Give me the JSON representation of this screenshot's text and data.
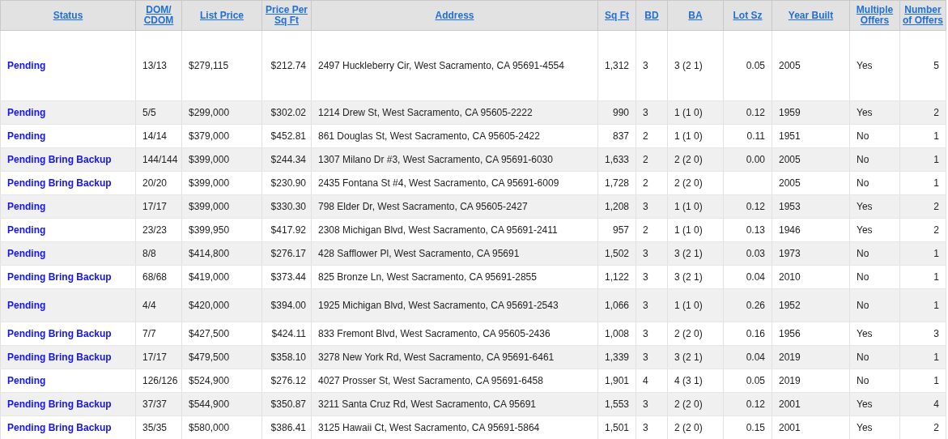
{
  "table": {
    "columns": [
      "Status",
      "DOM/ CDOM",
      "List Price",
      "Price Per Sq Ft",
      "Address",
      "Sq Ft",
      "BD",
      "BA",
      "Lot Sz",
      "Year Built",
      "Multiple Offers",
      "Number of Offers"
    ],
    "rows": [
      {
        "status": "Pending",
        "dom": "13/13",
        "list_price": "$279,115",
        "price_per_sqft": "$212.74",
        "address": "2497 Huckleberry Cir, West Sacramento, CA 95691-4554",
        "sqft": "1,312",
        "bd": "3",
        "ba": "3 (2 1)",
        "lot_sz": "0.05",
        "year_built": "2005",
        "multiple_offers": "Yes",
        "number_of_offers": "5"
      },
      {
        "status": "Pending",
        "dom": "5/5",
        "list_price": "$299,000",
        "price_per_sqft": "$302.02",
        "address": "1214 Drew St, West Sacramento, CA 95605-2222",
        "sqft": "990",
        "bd": "3",
        "ba": "1 (1 0)",
        "lot_sz": "0.12",
        "year_built": "1959",
        "multiple_offers": "Yes",
        "number_of_offers": "2"
      },
      {
        "status": "Pending",
        "dom": "14/14",
        "list_price": "$379,000",
        "price_per_sqft": "$452.81",
        "address": "861 Douglas St, West Sacramento, CA 95605-2422",
        "sqft": "837",
        "bd": "2",
        "ba": "1 (1 0)",
        "lot_sz": "0.11",
        "year_built": "1951",
        "multiple_offers": "No",
        "number_of_offers": "1"
      },
      {
        "status": "Pending Bring Backup",
        "dom": "144/144",
        "list_price": "$399,000",
        "price_per_sqft": "$244.34",
        "address": "1307 Milano Dr #3, West Sacramento, CA 95691-6030",
        "sqft": "1,633",
        "bd": "2",
        "ba": "2 (2 0)",
        "lot_sz": "0.00",
        "year_built": "2005",
        "multiple_offers": "No",
        "number_of_offers": "1"
      },
      {
        "status": "Pending Bring Backup",
        "dom": "20/20",
        "list_price": "$399,000",
        "price_per_sqft": "$230.90",
        "address": "2435 Fontana St #4, West Sacramento, CA 95691-6009",
        "sqft": "1,728",
        "bd": "2",
        "ba": "2 (2 0)",
        "year_built": "2005",
        "multiple_offers": "No",
        "number_of_offers": "1"
      },
      {
        "status": "Pending",
        "dom": "17/17",
        "list_price": "$399,000",
        "price_per_sqft": "$330.30",
        "address": "798 Elder Dr, West Sacramento, CA 95605-2427",
        "sqft": "1,208",
        "bd": "3",
        "ba": "1 (1 0)",
        "lot_sz": "0.12",
        "year_built": "1953",
        "multiple_offers": "Yes",
        "number_of_offers": "2"
      },
      {
        "status": "Pending",
        "dom": "23/23",
        "list_price": "$399,950",
        "price_per_sqft": "$417.92",
        "address": "2308 Michigan Blvd, West Sacramento, CA 95691-2411",
        "sqft": "957",
        "bd": "2",
        "ba": "1 (1 0)",
        "lot_sz": "0.13",
        "year_built": "1946",
        "multiple_offers": "Yes",
        "number_of_offers": "2"
      },
      {
        "status": "Pending",
        "dom": "8/8",
        "list_price": "$414,800",
        "price_per_sqft": "$276.17",
        "address": "428 Safflower Pl, West Sacramento, CA 95691",
        "sqft": "1,502",
        "bd": "3",
        "ba": "3 (2 1)",
        "lot_sz": "0.03",
        "year_built": "1973",
        "multiple_offers": "No",
        "number_of_offers": "1"
      },
      {
        "status": "Pending Bring Backup",
        "dom": "68/68",
        "list_price": "$419,000",
        "price_per_sqft": "$373.44",
        "address": "825 Bronze Ln, West Sacramento, CA 95691-2855",
        "sqft": "1,122",
        "bd": "3",
        "ba": "3 (2 1)",
        "lot_sz": "0.04",
        "year_built": "2010",
        "multiple_offers": "No",
        "number_of_offers": "1"
      },
      {
        "status": "Pending",
        "dom": "4/4",
        "list_price": "$420,000",
        "price_per_sqft": "$394.00",
        "address": "1925 Michigan Blvd, West Sacramento, CA 95691-2543",
        "sqft": "1,066",
        "bd": "3",
        "ba": "1 (1 0)",
        "lot_sz": "0.26",
        "year_built": "1952",
        "multiple_offers": "No",
        "number_of_offers": "1"
      },
      {
        "status": "Pending Bring Backup",
        "dom": "7/7",
        "list_price": "$427,500",
        "price_per_sqft": "$424.11",
        "address": "833 Fremont Blvd, West Sacramento, CA 95605-2436",
        "sqft": "1,008",
        "bd": "3",
        "ba": "2 (2 0)",
        "lot_sz": "0.16",
        "year_built": "1956",
        "multiple_offers": "Yes",
        "number_of_offers": "3"
      },
      {
        "status": "Pending Bring Backup",
        "dom": "17/17",
        "list_price": "$479,500",
        "price_per_sqft": "$358.10",
        "address": "3278 New York Rd, West Sacramento, CA 95691-6461",
        "sqft": "1,339",
        "bd": "3",
        "ba": "3 (2 1)",
        "lot_sz": "0.04",
        "year_built": "2019",
        "multiple_offers": "No",
        "number_of_offers": "1"
      },
      {
        "status": "Pending",
        "dom": "126/126",
        "list_price": "$524,900",
        "price_per_sqft": "$276.12",
        "address": "4027 Prosser St, West Sacramento, CA 95691-6458",
        "sqft": "1,901",
        "bd": "4",
        "ba": "4 (3 1)",
        "lot_sz": "0.05",
        "year_built": "2019",
        "multiple_offers": "No",
        "number_of_offers": "1"
      },
      {
        "status": "Pending Bring Backup",
        "dom": "37/37",
        "list_price": "$544,900",
        "price_per_sqft": "$350.87",
        "address": "3211 Santa Cruz Rd, West Sacramento, CA 95691",
        "sqft": "1,553",
        "bd": "3",
        "ba": "2 (2 0)",
        "lot_sz": "0.12",
        "year_built": "2001",
        "multiple_offers": "Yes",
        "number_of_offers": "4"
      },
      {
        "status": "Pending Bring Backup",
        "dom": "35/35",
        "list_price": "$580,000",
        "price_per_sqft": "$386.41",
        "address": "3125 Hawaii Ct, West Sacramento, CA 95691-5864",
        "sqft": "1,501",
        "bd": "3",
        "ba": "2 (2 0)",
        "lot_sz": "0.15",
        "year_built": "2001",
        "multiple_offers": "Yes",
        "number_of_offers": "2"
      }
    ]
  }
}
